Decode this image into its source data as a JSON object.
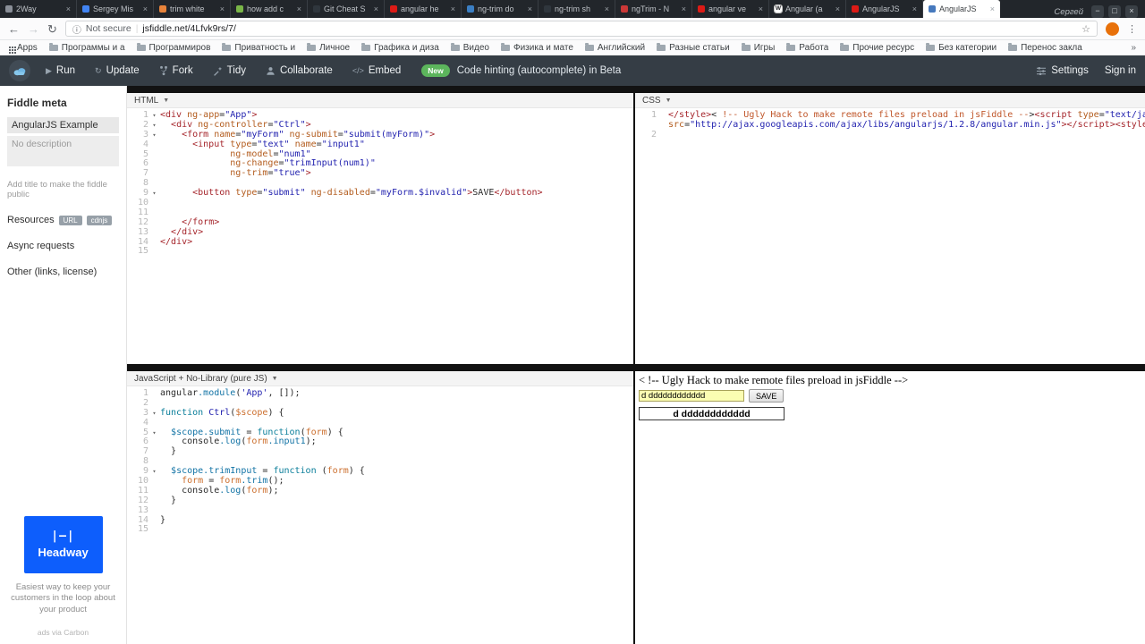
{
  "browser": {
    "window_label": "Сергей",
    "window_buttons": [
      "−",
      "□",
      "×"
    ],
    "tabs": [
      {
        "title": "2Way",
        "fav": "#8a8f98"
      },
      {
        "title": "Sergey Mis",
        "fav": "#4285f4"
      },
      {
        "title": "trim white",
        "fav": "#e8833a"
      },
      {
        "title": "how add c",
        "fav": "#7ab648"
      },
      {
        "title": "Git Cheat S",
        "fav": "#2f363d"
      },
      {
        "title": "angular he",
        "fav": "#dd1b16"
      },
      {
        "title": "ng-trim do",
        "fav": "#3b7fc4"
      },
      {
        "title": "ng-trim sh",
        "fav": "#2f363d"
      },
      {
        "title": "ngTrim - N",
        "fav": "#cb3837"
      },
      {
        "title": "angular ve",
        "fav": "#dd1b16"
      },
      {
        "title": "Angular (a",
        "fav": "#ffffff",
        "fav_text": "W"
      },
      {
        "title": "AngularJS",
        "fav": "#dd1b16"
      },
      {
        "title": "AngularJS",
        "fav": "#4679bd",
        "active": true
      }
    ],
    "toolbar": {
      "security_label": "Not secure",
      "url": "jsfiddle.net/4Lfvk9rs/7/"
    },
    "bookmarks": {
      "apps_label": "Apps",
      "items": [
        "Программы и а",
        "Программиров",
        "Приватность и",
        "Личное",
        "Графика и диза",
        "Видео",
        "Физика и мате",
        "Английский",
        "Разные статьи",
        "Игры",
        "Работа",
        "Прочие ресурс",
        "Без категории",
        "Перенос закла"
      ],
      "overflow": "»"
    }
  },
  "header": {
    "buttons": [
      {
        "id": "run",
        "label": "Run"
      },
      {
        "id": "update",
        "label": "Update"
      },
      {
        "id": "fork",
        "label": "Fork"
      },
      {
        "id": "tidy",
        "label": "Tidy"
      },
      {
        "id": "collaborate",
        "label": "Collaborate"
      },
      {
        "id": "embed",
        "label": "Embed"
      }
    ],
    "new_badge": "New",
    "beta_text": "Code hinting (autocomplete) in Beta",
    "settings_label": "Settings",
    "signin_label": "Sign in"
  },
  "sidebar": {
    "heading": "Fiddle meta",
    "title_value": "AngularJS Example",
    "description_placeholder": "No description",
    "helper": "Add title to make the fiddle public",
    "resources_label": "Resources",
    "resources_badges": [
      "URL",
      "cdnjs"
    ],
    "async_label": "Async requests",
    "other_label": "Other (links, license)",
    "ad": {
      "mark": "|–|",
      "brand": "Headway",
      "caption": "Easiest way to keep your customers in the loop about your product",
      "via": "ads via Carbon"
    }
  },
  "editors": {
    "html": {
      "title": "HTML",
      "lines": [
        {
          "n": "1",
          "f": 1,
          "t": [
            [
              "g",
              "<div "
            ],
            [
              "a",
              "ng-app"
            ],
            [
              "p",
              "="
            ],
            [
              "s",
              "\"App\""
            ],
            [
              "g",
              ">"
            ]
          ]
        },
        {
          "n": "2",
          "f": 1,
          "t": [
            [
              "p",
              "  "
            ],
            [
              "g",
              "<div "
            ],
            [
              "a",
              "ng-controller"
            ],
            [
              "p",
              "="
            ],
            [
              "s",
              "\"Ctrl\""
            ],
            [
              "g",
              ">"
            ]
          ]
        },
        {
          "n": "3",
          "f": 1,
          "t": [
            [
              "p",
              "    "
            ],
            [
              "g",
              "<form "
            ],
            [
              "a",
              "name"
            ],
            [
              "p",
              "="
            ],
            [
              "s",
              "\"myForm\""
            ],
            [
              "p",
              " "
            ],
            [
              "a",
              "ng-submit"
            ],
            [
              "p",
              "="
            ],
            [
              "s",
              "\"submit(myForm)\""
            ],
            [
              "g",
              ">"
            ]
          ]
        },
        {
          "n": "4",
          "t": [
            [
              "p",
              "      "
            ],
            [
              "g",
              "<input "
            ],
            [
              "a",
              "type"
            ],
            [
              "p",
              "="
            ],
            [
              "s",
              "\"text\""
            ],
            [
              "p",
              " "
            ],
            [
              "a",
              "name"
            ],
            [
              "p",
              "="
            ],
            [
              "s",
              "\"input1\""
            ]
          ]
        },
        {
          "n": "5",
          "t": [
            [
              "p",
              "             "
            ],
            [
              "a",
              "ng-model"
            ],
            [
              "p",
              "="
            ],
            [
              "s",
              "\"num1\""
            ]
          ]
        },
        {
          "n": "6",
          "t": [
            [
              "p",
              "             "
            ],
            [
              "a",
              "ng-change"
            ],
            [
              "p",
              "="
            ],
            [
              "s",
              "\"trimInput(num1)\""
            ]
          ]
        },
        {
          "n": "7",
          "t": [
            [
              "p",
              "             "
            ],
            [
              "a",
              "ng-trim"
            ],
            [
              "p",
              "="
            ],
            [
              "s",
              "\"true\""
            ],
            [
              "g",
              ">"
            ]
          ]
        },
        {
          "n": "8",
          "t": []
        },
        {
          "n": "9",
          "f": 1,
          "t": [
            [
              "p",
              "      "
            ],
            [
              "g",
              "<button "
            ],
            [
              "a",
              "type"
            ],
            [
              "p",
              "="
            ],
            [
              "s",
              "\"submit\""
            ],
            [
              "p",
              " "
            ],
            [
              "a",
              "ng-disabled"
            ],
            [
              "p",
              "="
            ],
            [
              "s",
              "\"myForm.$invalid\""
            ],
            [
              "g",
              ">"
            ],
            [
              "p",
              "SAVE"
            ],
            [
              "g",
              "</button>"
            ]
          ]
        },
        {
          "n": "10",
          "t": []
        },
        {
          "n": "11",
          "t": []
        },
        {
          "n": "12",
          "t": [
            [
              "p",
              "    "
            ],
            [
              "g",
              "</form>"
            ]
          ]
        },
        {
          "n": "13",
          "t": [
            [
              "p",
              "  "
            ],
            [
              "g",
              "</div>"
            ]
          ]
        },
        {
          "n": "14",
          "t": [
            [
              "g",
              "</div>"
            ]
          ]
        },
        {
          "n": "15",
          "t": []
        }
      ]
    },
    "css": {
      "title": "CSS",
      "lines": [
        {
          "n": "1",
          "t": [
            [
              "g",
              "</style>"
            ],
            [
              "p",
              "< "
            ],
            [
              "c",
              "!-- Ugly Hack to make remote files preload in jsFiddle --"
            ],
            [
              "p",
              ">"
            ],
            [
              "g",
              "<script "
            ],
            [
              "a",
              "type"
            ],
            [
              "p",
              "="
            ],
            [
              "s",
              "\"text/javascript\""
            ]
          ]
        },
        {
          "n": "",
          "t": [
            [
              "a",
              "src"
            ],
            [
              "p",
              "="
            ],
            [
              "s",
              "\"http://ajax.googleapis.com/ajax/libs/angularjs/1.2.8/angular.min.js\""
            ],
            [
              "g",
              "></script>"
            ],
            [
              "g",
              "<style>"
            ]
          ]
        },
        {
          "n": "2",
          "t": []
        }
      ]
    },
    "js": {
      "title": "JavaScript + No-Library (pure JS)",
      "lines": [
        {
          "n": "1",
          "t": [
            [
              "p",
              "angular"
            ],
            [
              "r",
              ".module"
            ],
            [
              "p",
              "("
            ],
            [
              "s",
              "'App'"
            ],
            [
              "p",
              ", []);"
            ]
          ]
        },
        {
          "n": "2",
          "t": []
        },
        {
          "n": "3",
          "f": 1,
          "t": [
            [
              "k",
              "function"
            ],
            [
              "p",
              " "
            ],
            [
              "s",
              "Ctrl"
            ],
            [
              "p",
              "("
            ],
            [
              "v",
              "$scope"
            ],
            [
              "p",
              ") {"
            ]
          ]
        },
        {
          "n": "4",
          "t": []
        },
        {
          "n": "5",
          "f": 1,
          "t": [
            [
              "p",
              "  "
            ],
            [
              "r",
              "$scope.submit"
            ],
            [
              "p",
              " = "
            ],
            [
              "k",
              "function"
            ],
            [
              "p",
              "("
            ],
            [
              "v",
              "form"
            ],
            [
              "p",
              ") {"
            ]
          ]
        },
        {
          "n": "6",
          "t": [
            [
              "p",
              "    console"
            ],
            [
              "r",
              ".log"
            ],
            [
              "p",
              "("
            ],
            [
              "v",
              "form"
            ],
            [
              "r",
              ".input1"
            ],
            [
              "p",
              ");"
            ]
          ]
        },
        {
          "n": "7",
          "t": [
            [
              "p",
              "  }"
            ]
          ]
        },
        {
          "n": "8",
          "t": []
        },
        {
          "n": "9",
          "f": 1,
          "t": [
            [
              "p",
              "  "
            ],
            [
              "r",
              "$scope.trimInput"
            ],
            [
              "p",
              " = "
            ],
            [
              "k",
              "function"
            ],
            [
              "p",
              " ("
            ],
            [
              "v",
              "form"
            ],
            [
              "p",
              ") {"
            ]
          ]
        },
        {
          "n": "10",
          "t": [
            [
              "p",
              "    "
            ],
            [
              "v",
              "form"
            ],
            [
              "p",
              " = "
            ],
            [
              "v",
              "form"
            ],
            [
              "r",
              ".trim"
            ],
            [
              "p",
              "();"
            ]
          ]
        },
        {
          "n": "11",
          "t": [
            [
              "p",
              "    console"
            ],
            [
              "r",
              ".log"
            ],
            [
              "p",
              "("
            ],
            [
              "v",
              "form"
            ],
            [
              "p",
              ");"
            ]
          ]
        },
        {
          "n": "12",
          "t": [
            [
              "p",
              "  }"
            ]
          ]
        },
        {
          "n": "13",
          "t": []
        },
        {
          "n": "14",
          "t": [
            [
              "p",
              "}"
            ]
          ]
        },
        {
          "n": "15",
          "t": []
        }
      ]
    }
  },
  "result": {
    "comment": "< !-- Ugly Hack to make remote files preload in jsFiddle -->",
    "input_value": "d dddddddddddd",
    "save_label": "SAVE",
    "echo_value": "d dddddddddddd"
  }
}
